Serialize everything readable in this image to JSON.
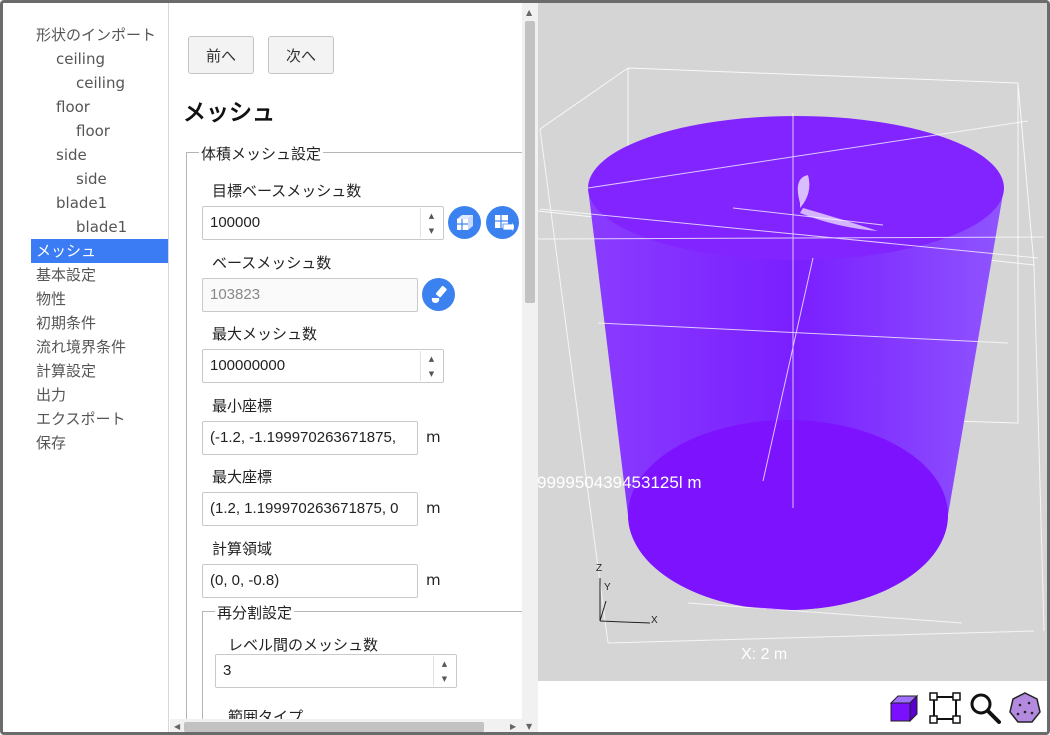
{
  "nav": {
    "items": [
      {
        "label": "形状のインポート"
      },
      {
        "label": "ceiling"
      },
      {
        "label": "ceiling"
      },
      {
        "label": "floor"
      },
      {
        "label": "floor"
      },
      {
        "label": "side"
      },
      {
        "label": "side"
      },
      {
        "label": "blade1"
      },
      {
        "label": "blade1"
      },
      {
        "label": "メッシュ"
      },
      {
        "label": "基本設定"
      },
      {
        "label": "物性"
      },
      {
        "label": "初期条件"
      },
      {
        "label": "流れ境界条件"
      },
      {
        "label": "計算設定"
      },
      {
        "label": "出力"
      },
      {
        "label": "エクスポート"
      },
      {
        "label": "保存"
      }
    ],
    "active": "メッシュ"
  },
  "panel": {
    "prev_label": "前へ",
    "next_label": "次へ",
    "title": "メッシュ",
    "volume_mesh": {
      "legend": "体積メッシュ設定",
      "target_base_label": "目標ベースメッシュ数",
      "target_base_value": "100000",
      "base_label": "ベースメッシュ数",
      "base_value": "103823",
      "max_mesh_label": "最大メッシュ数",
      "max_mesh_value": "100000000",
      "min_coord_label": "最小座標",
      "min_coord_value": "(-1.2, -1.199970263671875,",
      "min_coord_unit": "m",
      "max_coord_label": "最大座標",
      "max_coord_value": "(1.2, 1.199970263671875, 0",
      "max_coord_unit": "m",
      "domain_label": "計算領域",
      "domain_value": "(0, 0, -0.8)",
      "domain_unit": "m"
    },
    "refinement": {
      "legend": "再分割設定",
      "level_mesh_label": "レベル間のメッシュ数",
      "level_mesh_value": "3",
      "range_type_label": "範囲タイプ"
    }
  },
  "viewport": {
    "dimension_label": "999950439453125l m",
    "x_dim_label": "X: 2 m",
    "axes": {
      "z": "Z",
      "y": "Y",
      "x": "X"
    },
    "colors": {
      "background": "#d5d5d5",
      "mesh": "#7a10ff",
      "accent": "#3b7cf5"
    }
  },
  "toolbar": {
    "icons": [
      "box-view-icon",
      "fit-bounds-icon",
      "zoom-icon",
      "polyhedron-icon"
    ]
  }
}
